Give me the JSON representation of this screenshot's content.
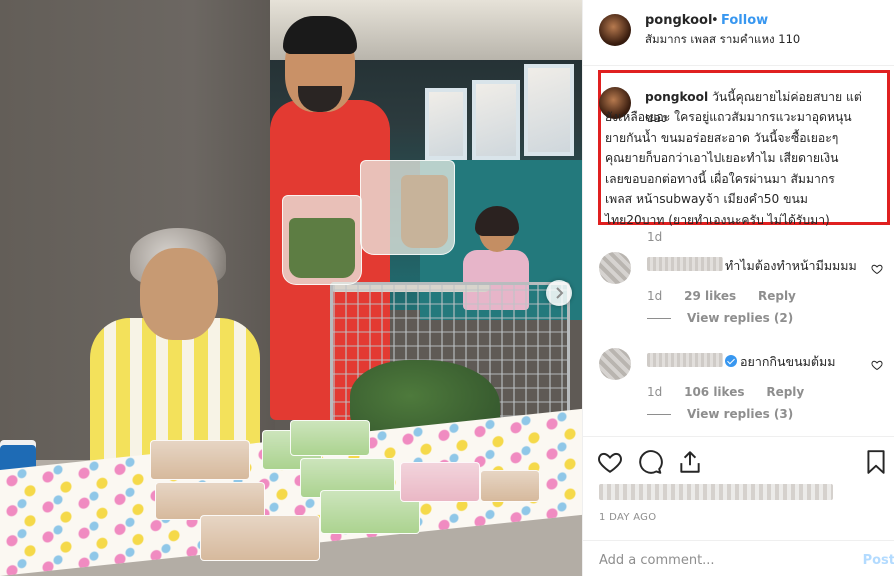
{
  "post": {
    "username": "pongkool",
    "follow_label": "Follow",
    "separator": "•",
    "location": "สัมมากร เพลส รามคำแหง 110"
  },
  "caption": {
    "username": "pongkool",
    "first_line": "วันนี้คุณยายไม่ค่อยสบาย แต่ของ",
    "lines": [
      "ยังเหลือเยอะ ใครอยู่แถวสัมมากรแวะมาอุดหนุน",
      "ยายกันน้ำ ขนมอร่อยสะอาด วันนี้จะซื้อเยอะๆ",
      "คุณยายก็บอกว่าเอาไปเยอะทำไม เสียดายเงิน",
      "เลยขอบอกต่อทางนี้ เผื่อใครผ่านมา สัมมากร",
      "เพลส หน้าsubwayจ้า เมียงคำ50 ขนม",
      "ไทย20บาท (ยายทำเองนะครับ ไม่ได้รับมา)"
    ],
    "time": "1d"
  },
  "comments": [
    {
      "text": "ทำไมต้องทำหน้ามีมมมม",
      "time": "1d",
      "likes": "29 likes",
      "reply_label": "Reply",
      "view_replies": "View replies (2)"
    },
    {
      "text": "อยากกินขนมต้มม",
      "time": "1d",
      "likes": "106 likes",
      "reply_label": "Reply",
      "view_replies": "View replies (3)"
    }
  ],
  "footer": {
    "time_ago": "1 DAY AGO",
    "add_comment_placeholder": "Add a comment...",
    "post_label": "Post"
  },
  "colors": {
    "accent": "#3897f0",
    "highlight_box": "#e02020",
    "muted": "#8e8e8e"
  }
}
